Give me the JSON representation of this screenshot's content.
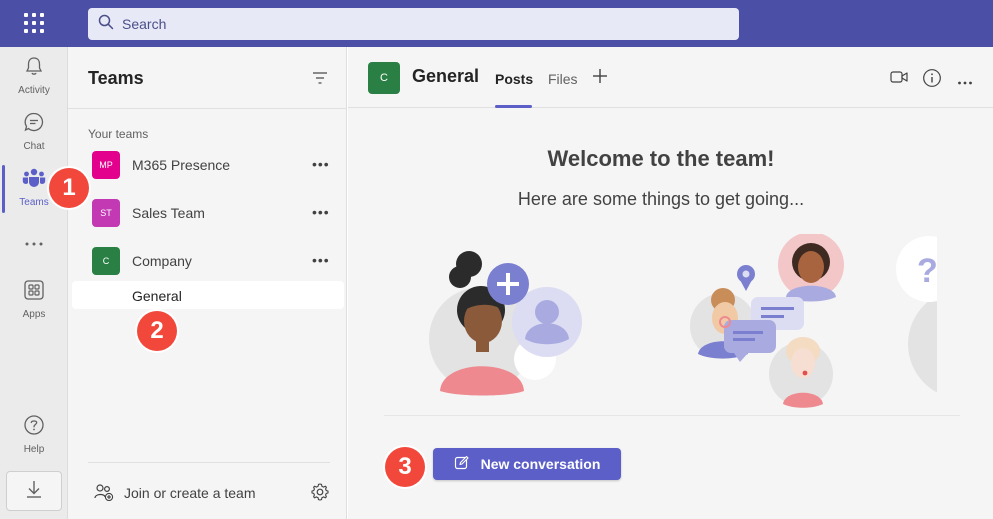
{
  "search": {
    "placeholder": "Search"
  },
  "rail": {
    "items": [
      {
        "label": "Activity",
        "icon": "bell-icon"
      },
      {
        "label": "Chat",
        "icon": "chat-icon"
      },
      {
        "label": "Teams",
        "icon": "teams-icon",
        "active": true
      },
      {
        "label": "",
        "icon": "more-icon"
      },
      {
        "label": "Apps",
        "icon": "apps-icon"
      },
      {
        "label": "Help",
        "icon": "help-icon"
      }
    ],
    "download_icon": "download-icon"
  },
  "panel": {
    "title": "Teams",
    "section_label": "Your teams",
    "teams": [
      {
        "initials": "MP",
        "name": "M365 Presence",
        "color": "#e3008c"
      },
      {
        "initials": "ST",
        "name": "Sales Team",
        "color": "#c239b3"
      },
      {
        "initials": "C",
        "name": "Company",
        "color": "#2a8044"
      }
    ],
    "selected_channel": "General",
    "join_label": "Join or create a team"
  },
  "main": {
    "channel_initial": "C",
    "channel_title": "General",
    "tabs": [
      {
        "label": "Posts",
        "active": true
      },
      {
        "label": "Files"
      }
    ],
    "welcome": "Welcome to the team!",
    "subtitle": "Here are some things to get going...",
    "new_conversation_label": "New conversation"
  },
  "markers": [
    "1",
    "2",
    "3"
  ],
  "colors": {
    "brand": "#4b4fa6",
    "accent": "#5b5fc7",
    "marker": "#f2483b"
  }
}
